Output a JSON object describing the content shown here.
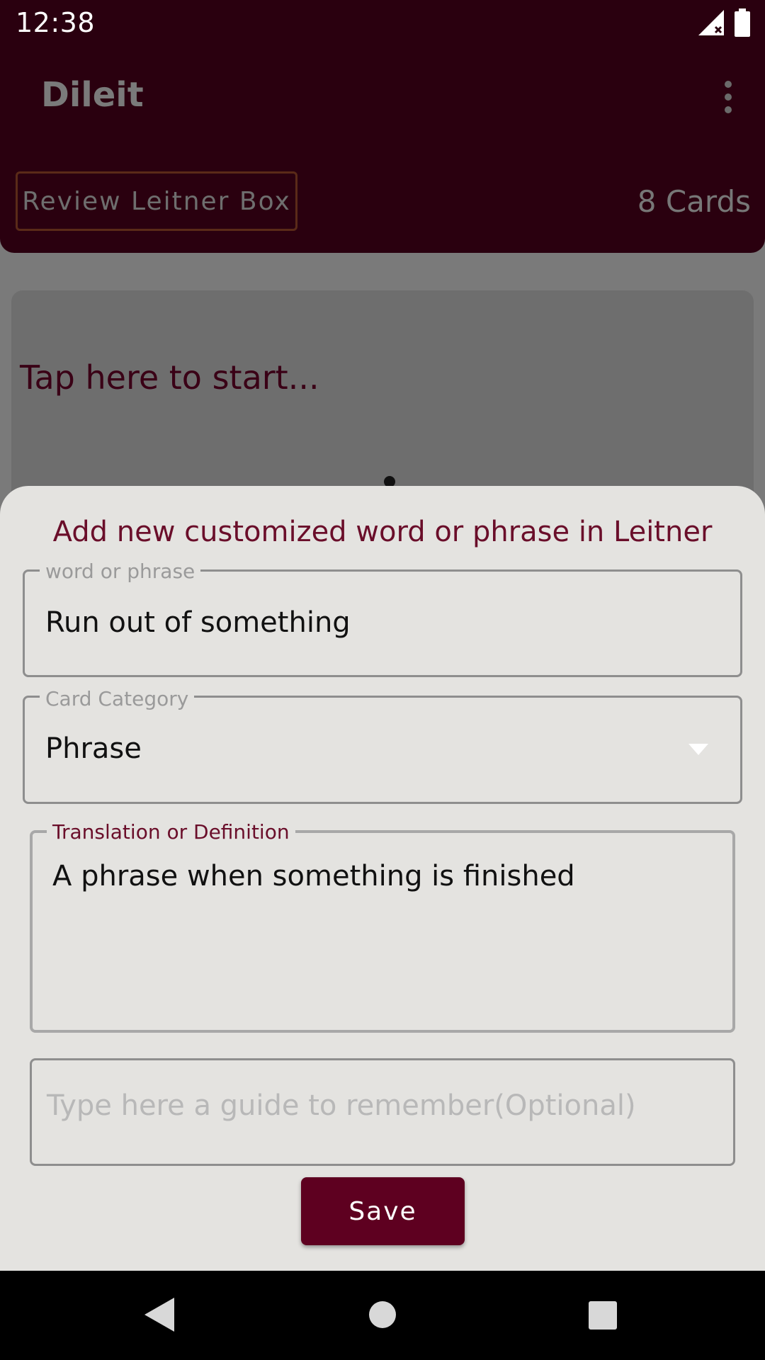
{
  "status_bar": {
    "time": "12:38",
    "icons": [
      "signal-no-data-icon",
      "battery-full-icon"
    ]
  },
  "app_bar": {
    "title": "Dileit",
    "menu_icon": "overflow-menu-icon",
    "review_button": "Review Leitner Box",
    "cards_count": "8 Cards"
  },
  "main": {
    "start_prompt": "Tap here to start..."
  },
  "sheet": {
    "title": "Add new customized word or phrase in Leitner",
    "word_field": {
      "label": "word or phrase",
      "value": "Run out of something"
    },
    "category_field": {
      "label": "Card Category",
      "value": "Phrase",
      "icon": "dropdown-arrow-icon"
    },
    "translation_field": {
      "label": "Translation or Definition",
      "value": "A phrase when something is finished"
    },
    "guide_field": {
      "placeholder": "Type here a guide to remember(Optional)",
      "value": ""
    },
    "save_label": "Save"
  },
  "nav_bar": {
    "icons": [
      "back-icon",
      "home-icon",
      "recents-icon"
    ]
  },
  "colors": {
    "app_bar_bg": "#2a000f",
    "accent": "#6a0e2a",
    "save_button_bg": "#5e0020",
    "sheet_bg": "#e4e3e0",
    "scrim": "#7a7a7a"
  }
}
